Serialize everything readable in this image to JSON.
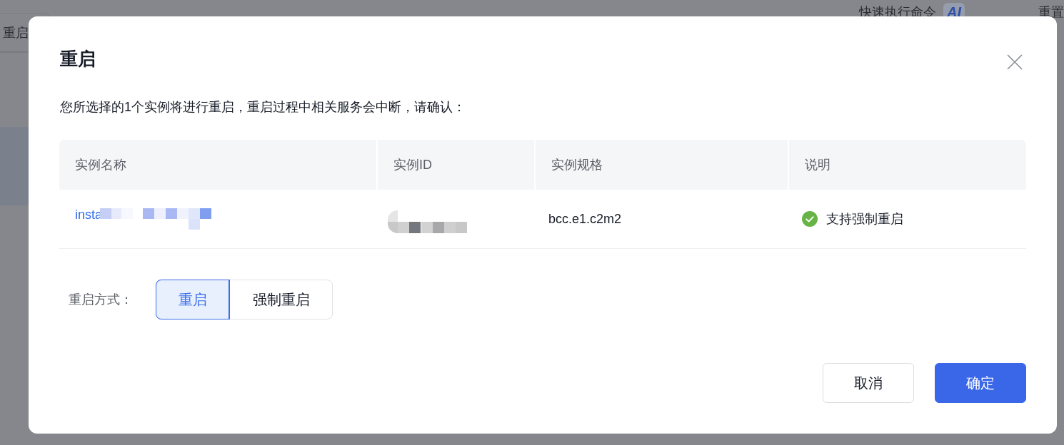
{
  "background": {
    "toolbar_button": "重启",
    "panel_title": "快速执行命令",
    "panel_badge": "AI",
    "panel_action": "重置",
    "row_highlighted": true
  },
  "dialog": {
    "title": "重启",
    "message": "您所选择的1个实例将进行重启，重启过程中相关服务会中断，请确认：",
    "table": {
      "columns": [
        "实例名称",
        "实例ID",
        "实例规格",
        "说明"
      ],
      "rows": [
        {
          "name": "insta",
          "name_redacted": true,
          "id_redacted": true,
          "spec": "bcc.e1.c2m2",
          "note": "支持强制重启",
          "note_checked": true
        }
      ]
    },
    "mode": {
      "label": "重启方式：",
      "options": [
        {
          "label": "重启",
          "selected": true
        },
        {
          "label": "强制重启",
          "selected": false
        }
      ]
    },
    "buttons": [
      {
        "label": "取消",
        "kind": "secondary"
      },
      {
        "label": "确定",
        "kind": "primary"
      }
    ]
  }
}
